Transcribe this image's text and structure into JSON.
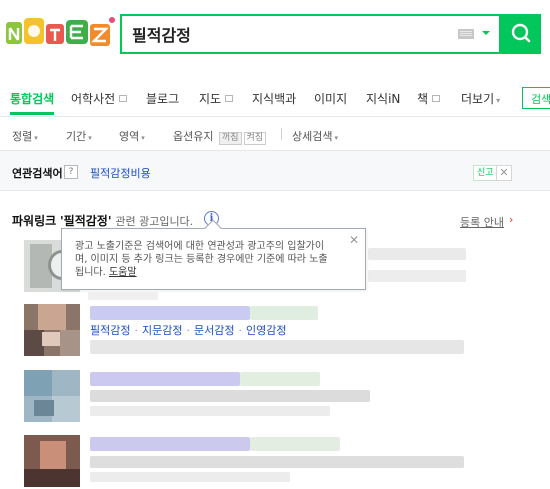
{
  "search": {
    "query": "필적감정"
  },
  "tabs": [
    {
      "label": "통합검색",
      "active": true
    },
    {
      "label": "어학사전",
      "new_window": true
    },
    {
      "label": "블로그"
    },
    {
      "label": "지도",
      "new_window": true
    },
    {
      "label": "지식백과"
    },
    {
      "label": "이미지"
    },
    {
      "label": "지식iN"
    },
    {
      "label": "책",
      "new_window": true
    },
    {
      "label": "더보기",
      "caret": true
    }
  ],
  "tab_more_input": "검색",
  "options": {
    "sort": "정렬",
    "period": "기간",
    "area": "영역",
    "option_keep": "옵션유지",
    "option_on": "꺼짐",
    "option_off": "켜짐",
    "detail": "상세검색"
  },
  "related": {
    "title": "연관검색어",
    "help": "?",
    "keyword": "필적감정비용",
    "report": "신고",
    "close": "✕"
  },
  "power_link": {
    "prefix": "파워링크",
    "query": "'필적감정'",
    "suffix": "관련 광고입니다.",
    "info": "i",
    "register": "등록 안내",
    "register_arrow": "›"
  },
  "tooltip": {
    "text": "광고 노출기준은 검색어에 대한 연관성과 광고주의 입찰가이며, 이미지 등 추가 링크는 등록한 경우에만 기준에 따라 노출됩니다.",
    "link": "도움말",
    "close": "✕"
  },
  "ad_links": [
    "필적감정",
    "지문감정",
    "문서감정",
    "인영감정"
  ],
  "colors": {
    "brand_green": "#03c75a",
    "link_blue": "#1a4dc8"
  }
}
